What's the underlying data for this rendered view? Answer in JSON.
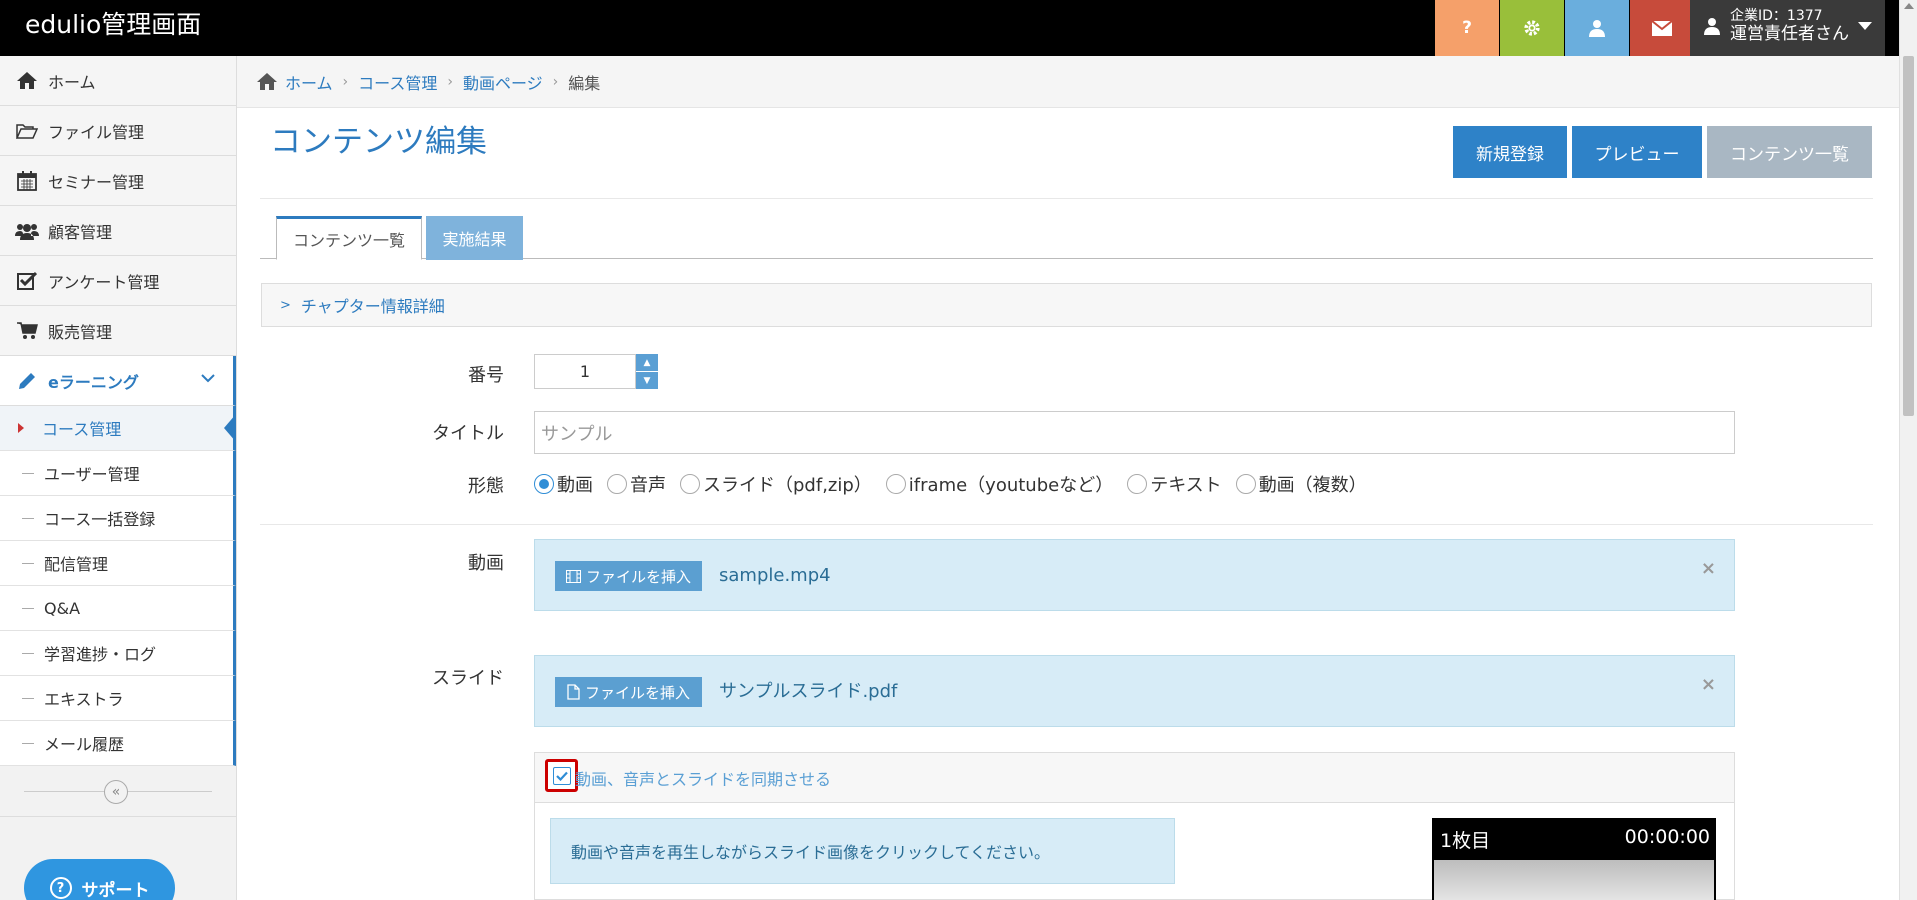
{
  "app": {
    "brand": "edulio管理画面"
  },
  "topbar": {
    "help_icon": "question-icon",
    "settings_icon": "gear-icon",
    "user_icon": "user-icon",
    "mail_icon": "envelope-icon",
    "company_id": "企業ID：1377",
    "role": "運営責任者さん",
    "colors": {
      "help": "#f5a06a",
      "settings": "#99bf3a",
      "user": "#6aaedd",
      "mail": "#c74b3b"
    }
  },
  "sidebar": {
    "items": [
      {
        "label": "ホーム",
        "icon": "home-icon"
      },
      {
        "label": "ファイル管理",
        "icon": "folder-open-icon"
      },
      {
        "label": "セミナー管理",
        "icon": "calendar-icon"
      },
      {
        "label": "顧客管理",
        "icon": "users-icon"
      },
      {
        "label": "アンケート管理",
        "icon": "check-square-icon"
      },
      {
        "label": "販売管理",
        "icon": "cart-icon"
      }
    ],
    "elearning": {
      "label": "eラーニング",
      "icon": "pencil-icon"
    },
    "sub_items": [
      {
        "label": "コース管理",
        "active": true
      },
      {
        "label": "ユーザー管理"
      },
      {
        "label": "コース一括登録"
      },
      {
        "label": "配信管理"
      },
      {
        "label": "Q&A"
      },
      {
        "label": "学習進捗・ログ"
      },
      {
        "label": "エキストラ"
      },
      {
        "label": "メール履歴"
      }
    ],
    "collapse_glyph": "«",
    "support_label": "サポート"
  },
  "breadcrumb": {
    "home": "ホーム",
    "course": "コース管理",
    "video_page": "動画ページ",
    "current": "編集",
    "sep": "›"
  },
  "main": {
    "title": "コンテンツ編集",
    "buttons": {
      "new": "新規登録",
      "preview": "プレビュー",
      "list": "コンテンツ一覧"
    },
    "tabs": {
      "contents": "コンテンツ一覧",
      "results": "実施結果"
    },
    "chapter_details": "チャプター情報詳細",
    "form": {
      "number_label": "番号",
      "number_value": "1",
      "title_label": "タイトル",
      "title_placeholder": "サンプル",
      "form_label": "形態",
      "options": [
        {
          "label": "動画",
          "checked": true
        },
        {
          "label": "音声"
        },
        {
          "label": "スライド（pdf,zip）"
        },
        {
          "label": "iframe（youtubeなど）"
        },
        {
          "label": "テキスト"
        },
        {
          "label": "動画（複数）"
        }
      ],
      "video_label": "動画",
      "video_insert": "ファイルを挿入",
      "video_file": "sample.mp4",
      "slide_label": "スライド",
      "slide_insert": "ファイルを挿入",
      "slide_file": "サンプルスライド.pdf",
      "close_glyph": "×",
      "sync_label": "動画、音声とスライドを同期させる",
      "sync_checked": true,
      "sync_note": "動画や音声を再生しながらスライド画像をクリックしてください。",
      "preview_page": "1枚目",
      "preview_time": "00:00:00"
    }
  }
}
